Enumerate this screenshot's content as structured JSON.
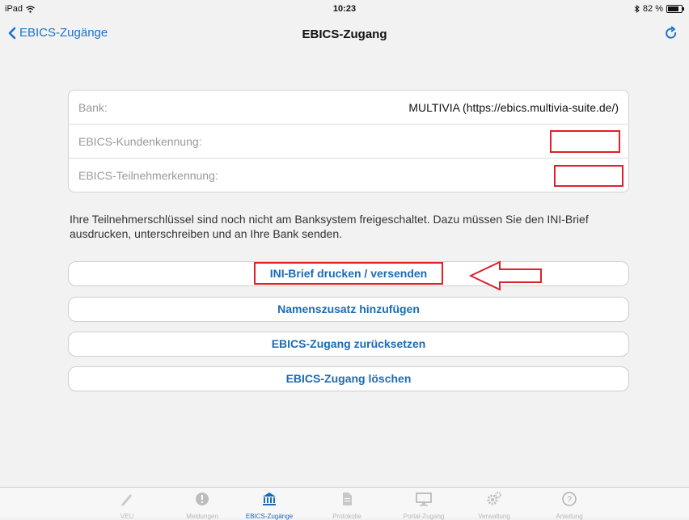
{
  "status": {
    "device": "iPad",
    "time": "10:23",
    "battery": "82 %",
    "battery_level": 0.82
  },
  "nav": {
    "back_label": "EBICS-Zugänge",
    "title": "EBICS-Zugang"
  },
  "card": {
    "rows": [
      {
        "label": "Bank:",
        "value": "MULTIVIA (https://ebics.multivia-suite.de/)"
      },
      {
        "label": "EBICS-Kundenkennung:",
        "value": ""
      },
      {
        "label": "EBICS-Teilnehmerkennung:",
        "value": ""
      }
    ]
  },
  "notice": "Ihre Teilnehmerschlüssel sind noch nicht am Banksystem freigeschaltet. Dazu müssen Sie den INI-Brief ausdrucken, unterschreiben und an Ihre Bank senden.",
  "actions": {
    "print_ini": "INI-Brief drucken / versenden",
    "add_name": "Namenszusatz hinzufügen",
    "reset": "EBICS-Zugang zurücksetzen",
    "delete": "EBICS-Zugang löschen"
  },
  "colors": {
    "accent": "#1a6bb8",
    "annotation": "#e0202a"
  },
  "tabbar": {
    "tabs": [
      {
        "label": "VEU",
        "icon": "pencil-icon"
      },
      {
        "label": "Meldungen",
        "icon": "alert-icon"
      },
      {
        "label": "EBICS-Zugänge",
        "icon": "bank-icon",
        "active": true
      },
      {
        "label": "Protokolle",
        "icon": "document-icon"
      },
      {
        "label": "Portal-Zugang",
        "icon": "monitor-icon"
      },
      {
        "label": "Verwaltung",
        "icon": "gears-icon"
      },
      {
        "label": "Anleitung",
        "icon": "help-icon"
      }
    ]
  }
}
